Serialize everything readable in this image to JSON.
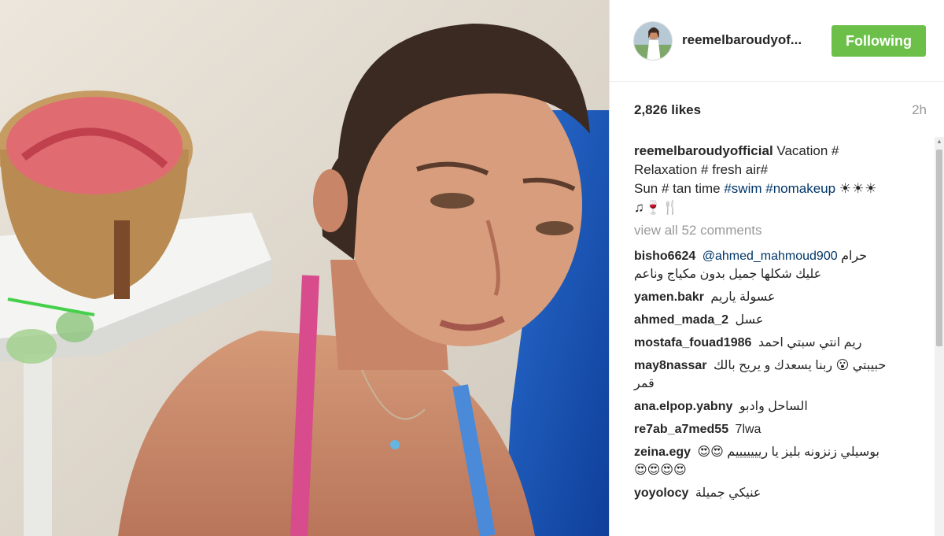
{
  "post": {
    "username": "reemelbaroudyof...",
    "follow_button": "Following",
    "likes": "2,826 likes",
    "time": "2h",
    "caption": {
      "user": "reemelbaroudyofficial",
      "text1": " Vacation #",
      "line2": "Relaxation # fresh air#",
      "line3_a": "Sun # tan time ",
      "tag_swim": "#swim",
      "tag_nomakeup": "#nomakeup",
      "emoji_1": "☀☀☀",
      "emoji_2": "♫🍷🍴"
    },
    "view_all": "view all 52 comments"
  },
  "comments": [
    {
      "user": "bisho6624",
      "mention": "@ahmed_mahmoud900",
      "text": "حرام",
      "text2": "عليك شكلها جميل بدون مكياج وناعم"
    },
    {
      "user": "yamen.bakr",
      "text": "عسولة ياريم"
    },
    {
      "user": "ahmed_mada_2",
      "text": "عسل"
    },
    {
      "user": "mostafa_fouad1986",
      "text": "ريم انتي سبتي احمد"
    },
    {
      "user": "may8nassar",
      "text": "حبيبتي 😮 ربنا يسعدك و يريح بالك",
      "text2": "قمر"
    },
    {
      "user": "ana.elpop.yabny",
      "text": "الساحل وادبو"
    },
    {
      "user": "re7ab_a7med55",
      "text": "7lwa"
    },
    {
      "user": "zeina.egy",
      "text": "بوسيلي زنزونه بليز يا ريييييييم 😍😍",
      "text2": "😍😍😍😍"
    },
    {
      "user": "yoyolocy",
      "text": "عنيكي جميلة"
    }
  ],
  "icons": {
    "scroll_up": "▲"
  },
  "colors": {
    "follow_bg": "#6cc04a",
    "hashtag": "#003569",
    "muted": "#999999"
  }
}
